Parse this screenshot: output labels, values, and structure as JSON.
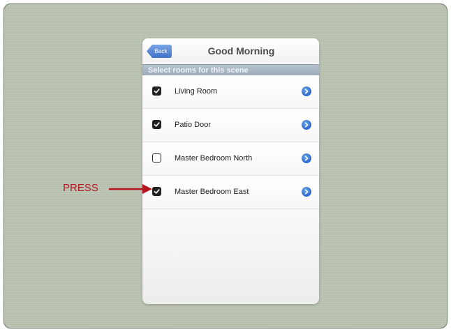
{
  "navbar": {
    "back_label": "Back",
    "title": "Good Morning"
  },
  "section": {
    "header": "Select rooms for this scene"
  },
  "rooms": [
    {
      "label": "Living Room",
      "checked": true
    },
    {
      "label": "Patio Door",
      "checked": true
    },
    {
      "label": "Master Bedroom North",
      "checked": false
    },
    {
      "label": "Master Bedroom East",
      "checked": true
    }
  ],
  "annotation": {
    "label": "PRESS",
    "color": "#b31621"
  },
  "icons": {
    "checkbox_check": "check-icon",
    "disclosure": "chevron-right-icon",
    "annotation_arrow": "arrow-right-icon"
  },
  "colors": {
    "background": "#bac3b1",
    "accent": "#3f72c9",
    "section_header": "#a7b4c1"
  }
}
